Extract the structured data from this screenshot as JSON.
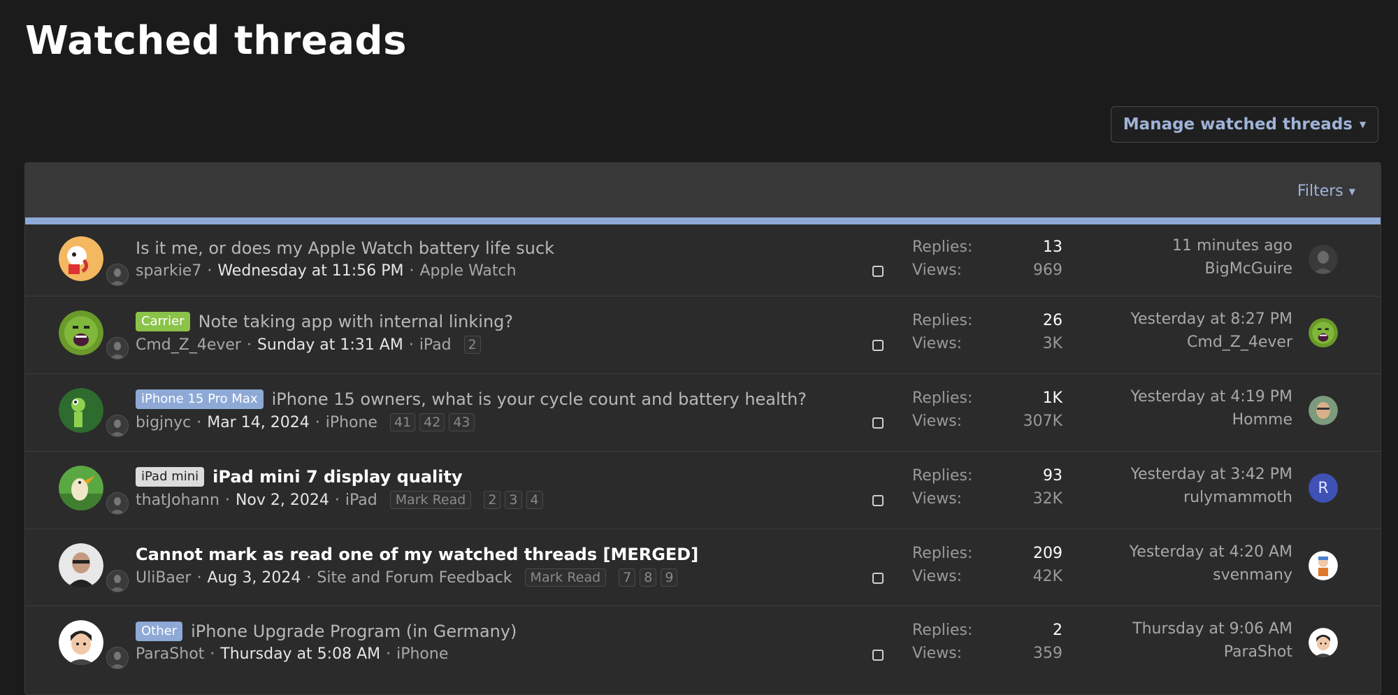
{
  "page_title": "Watched threads",
  "manage_button": "Manage watched threads",
  "filters_label": "Filters",
  "stat_labels": {
    "replies": "Replies:",
    "views": "Views:"
  },
  "threads": [
    {
      "prefix": "",
      "title": "Is it me, or does my Apple Watch battery life suck",
      "unread": false,
      "author": "sparkie7",
      "date": "Wednesday at 11:56 PM",
      "forum": "Apple Watch",
      "mark_read": "",
      "pages": [],
      "replies": "13",
      "views": "969",
      "last_time": "11 minutes ago",
      "last_user": "BigMcGuire",
      "avatar_icon": "cartoon-dog-avatar",
      "last_avatar_icon": "dark-photo-avatar"
    },
    {
      "prefix": "Carrier",
      "prefix_bg": "#8bc34a",
      "prefix_fg": "#ffffff",
      "title": "Note taking app with internal linking?",
      "unread": false,
      "author": "Cmd_Z_4ever",
      "date": "Sunday at 1:31 AM",
      "forum": "iPad",
      "mark_read": "",
      "pages": [
        "2"
      ],
      "replies": "26",
      "views": "3K",
      "last_time": "Yesterday at 8:27 PM",
      "last_user": "Cmd_Z_4ever",
      "avatar_icon": "green-hulk-avatar",
      "last_avatar_icon": "green-hulk-avatar"
    },
    {
      "prefix": "iPhone 15 Pro Max",
      "prefix_bg": "#8ea9d6",
      "prefix_fg": "#ffffff",
      "title": "iPhone 15 owners, what is your cycle count and battery health?",
      "unread": false,
      "author": "bigjnyc",
      "date": "Mar 14, 2024",
      "forum": "iPhone",
      "mark_read": "",
      "pages": [
        "41",
        "42",
        "43"
      ],
      "replies": "1K",
      "views": "307K",
      "last_time": "Yesterday at 4:19 PM",
      "last_user": "Homme",
      "avatar_icon": "green-frog-avatar",
      "last_avatar_icon": "face-photo-avatar"
    },
    {
      "prefix": "iPad mini",
      "prefix_bg": "#dcdcdc",
      "prefix_fg": "#222222",
      "title": "iPad mini 7 display quality",
      "unread": true,
      "author": "thatJohann",
      "date": "Nov 2, 2024",
      "forum": "iPad",
      "mark_read": "Mark Read",
      "pages": [
        "2",
        "3",
        "4"
      ],
      "replies": "93",
      "views": "32K",
      "last_time": "Yesterday at 3:42 PM",
      "last_user": "rulymammoth",
      "avatar_icon": "cartoon-bird-avatar",
      "last_avatar_letter": "R",
      "last_avatar_color": "#3f51b5"
    },
    {
      "prefix": "",
      "title": "Cannot mark as read one of my watched threads [MERGED]",
      "unread": true,
      "author": "UliBaer",
      "date": "Aug 3, 2024",
      "forum": "Site and Forum Feedback",
      "mark_read": "Mark Read",
      "pages": [
        "7",
        "8",
        "9"
      ],
      "replies": "209",
      "views": "42K",
      "last_time": "Yesterday at 4:20 AM",
      "last_user": "svenmany",
      "avatar_icon": "man-photo-avatar",
      "last_avatar_icon": "cartoon-person-avatar"
    },
    {
      "prefix": "Other",
      "prefix_bg": "#8ea9d6",
      "prefix_fg": "#ffffff",
      "title": "iPhone Upgrade Program (in Germany)",
      "unread": false,
      "author": "ParaShot",
      "date": "Thursday at 5:08 AM",
      "forum": "iPhone",
      "mark_read": "",
      "pages": [],
      "replies": "2",
      "views": "359",
      "last_time": "Thursday at 9:06 AM",
      "last_user": "ParaShot",
      "avatar_icon": "memoji-avatar",
      "last_avatar_icon": "memoji-avatar"
    }
  ]
}
